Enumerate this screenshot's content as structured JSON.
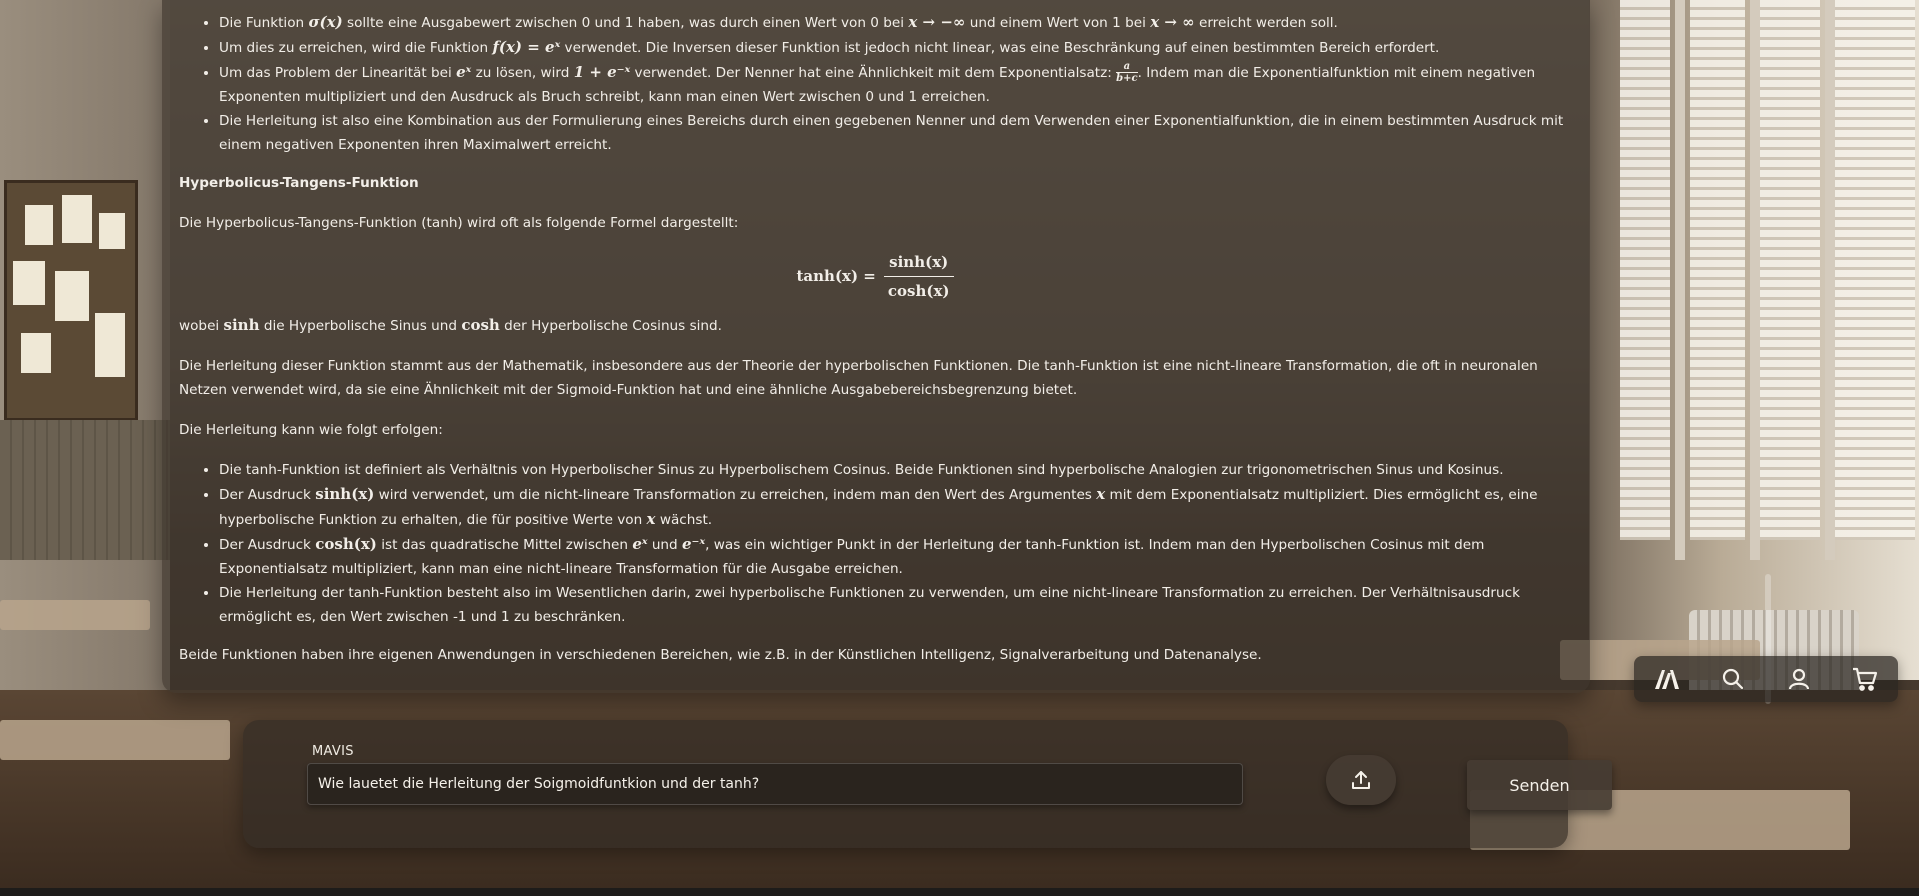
{
  "response": {
    "sigmoid_bullets": [
      {
        "t1": "Die Funktion ",
        "m1": "σ(x)",
        "t2": " sollte eine Ausgabewert zwischen 0 und 1 haben, was durch einen Wert von 0 bei ",
        "m2": "x → −∞",
        "t3": " und einem Wert von 1 bei ",
        "m3": "x → ∞",
        "t4": " erreicht werden soll."
      },
      {
        "t1": "Um dies zu erreichen, wird die Funktion ",
        "m1": "f(x) = eˣ",
        "t2": " verwendet. Die Inversen dieser Funktion ist jedoch nicht linear, was eine Beschränkung auf einen bestimmten Bereich erfordert."
      },
      {
        "t1": "Um das Problem der Linearität bei ",
        "m1": "eˣ",
        "t2": " zu lösen, wird ",
        "m2": "1 + e⁻ˣ",
        "t3": " verwendet. Der Nenner hat eine Ähnlichkeit mit dem Exponentialsatz: ",
        "frac_num": "a",
        "frac_den": "b+c",
        "t4": ". Indem man die Exponentialfunktion mit einem negativen Exponenten multipliziert und den Ausdruck als Bruch schreibt, kann man einen Wert zwischen 0 und 1 erreichen."
      },
      {
        "t1": "Die Herleitung ist also eine Kombination aus der Formulierung eines Bereichs durch einen gegebenen Nenner und dem Verwenden einer Exponentialfunktion, die in einem bestimmten Ausdruck mit einem negativen Exponenten ihren Maximalwert erreicht."
      }
    ],
    "tanh_heading": "Hyperbolicus-Tangens-Funktion",
    "tanh_intro": "Die Hyperbolicus-Tangens-Funktion (tanh) wird oft als folgende Formel dargestellt:",
    "formula": {
      "lhs": "tanh(x) =",
      "num": "sinh(x)",
      "den": "cosh(x)"
    },
    "where": {
      "t1": "wobei ",
      "m1": "sinh",
      "t2": " die Hyperbolische Sinus und ",
      "m2": "cosh",
      "t3": " der Hyperbolische Cosinus sind."
    },
    "origin": "Die Herleitung dieser Funktion stammt aus der Mathematik, insbesondere aus der Theorie der hyperbolischen Funktionen. Die tanh-Funktion ist eine nicht-lineare Transformation, die oft in neuronalen Netzen verwendet wird, da sie eine Ähnlichkeit mit der Sigmoid-Funktion hat und eine ähnliche Ausgabebereichsbegrenzung bietet.",
    "derivation_intro": "Die Herleitung kann wie folgt erfolgen:",
    "tanh_bullets": [
      {
        "t1": "Die tanh-Funktion ist definiert als Verhältnis von Hyperbolischer Sinus zu Hyperbolischem Cosinus. Beide Funktionen sind hyperbolische Analogien zur trigonometrischen Sinus und Kosinus."
      },
      {
        "t1": "Der Ausdruck ",
        "m1": "sinh(x)",
        "t2": " wird verwendet, um die nicht-lineare Transformation zu erreichen, indem man den Wert des Argumentes ",
        "m2": "x",
        "t3": " mit dem Exponentialsatz multipliziert. Dies ermöglicht es, eine hyperbolische Funktion zu erhalten, die für positive Werte von ",
        "m3": "x",
        "t4": " wächst."
      },
      {
        "t1": "Der Ausdruck ",
        "m1": "cosh(x)",
        "t2": " ist das quadratische Mittel zwischen ",
        "m2": "eˣ",
        "t3": " und ",
        "m3": "e⁻ˣ",
        "t4": ", was ein wichtiger Punkt in der Herleitung der tanh-Funktion ist. Indem man den Hyperbolischen Cosinus mit dem Exponentialsatz multipliziert, kann man eine nicht-lineare Transformation für die Ausgabe erreichen."
      },
      {
        "t1": "Die Herleitung der tanh-Funktion besteht also im Wesentlichen darin, zwei hyperbolische Funktionen zu verwenden, um eine nicht-lineare Transformation zu erreichen. Der Verhältnisausdruck ermöglicht es, den Wert zwischen -1 und 1 zu beschränken."
      }
    ],
    "conclusion": "Beide Funktionen haben ihre eigenen Anwendungen in verschiedenen Bereichen, wie z.B. in der Künstlichen Intelligenz, Signalverarbeitung und Datenanalyse."
  },
  "nav": {
    "icons": [
      "logo-icon",
      "search-icon",
      "user-icon",
      "cart-icon"
    ]
  },
  "composer": {
    "label": "MAVIS",
    "input_value": "Wie lauetet die Herleitung der Soigmoidfuntkion und der tanh?",
    "upload_icon": "upload-icon",
    "send_label": "Senden"
  },
  "colors": {
    "text": "#f2eee8",
    "panel": "#3a322a",
    "button": "#463c33"
  }
}
